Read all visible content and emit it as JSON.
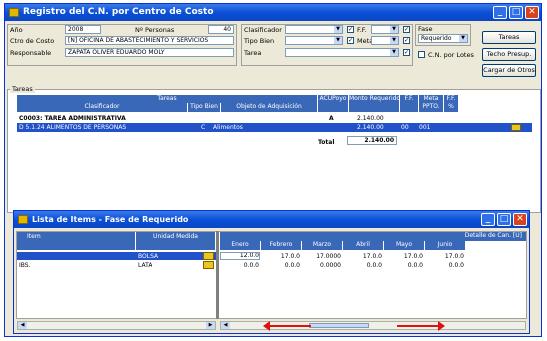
{
  "window": {
    "title": "Registro del C.N. por Centro de Costo"
  },
  "header": {
    "ano_label": "Año",
    "ano_value": "2008",
    "nro_personas_label": "Nº Personas",
    "nro_personas_value": "40",
    "centro_costo_label": "Ctro de Costo",
    "centro_costo_value": "[N] OFICINA DE ABASTECIMIENTO Y SERVICIOS",
    "responsable_label": "Responsable",
    "responsable_value": "ZAPATA OLIVER EDUARDO MOLY",
    "clasificador_label": "Clasificador",
    "tipo_bien_label": "Tipo Bien",
    "tarea_label": "Tarea",
    "ff_label": "F.F.",
    "meta_label": "Meta",
    "fase_label": "Fase",
    "fase_value": "Requerido",
    "cn_por_lotes_label": "C.N. por Lotes",
    "tareas_btn": "Tareas",
    "techo_btn": "Techo Presup.",
    "cargar_btn": "Cargar de Otros"
  },
  "tareas_group": {
    "label": "Tareas",
    "header_top": "Tareas",
    "columns": [
      "Clasificador",
      "Tipo Bien",
      "Objeto de Adquisición",
      "ACUPoyo",
      "Monto Requerido",
      "F.F.",
      "Meta",
      "F.F."
    ],
    "sub_columns": [
      "",
      "",
      "",
      "",
      "",
      "",
      "PPTO.",
      "%"
    ],
    "rows": [
      {
        "c1": "C0003: TAREA ADMINISTRATIVA",
        "c2": "",
        "c3": "",
        "c4": "A",
        "c5": "2.140.00",
        "c6": "",
        "c7": "",
        "bold": true
      },
      {
        "c1": "D    5.1.24   ALIMENTOS DE PERSONAS",
        "c2": "C",
        "c3": "Alimentos",
        "c4": "",
        "c5": "2.140.00",
        "c6": "00",
        "c7": "001",
        "selected": true
      }
    ],
    "total_label": "Total",
    "total_value": "2.140.00"
  },
  "items_window": {
    "title": "Lista de Items - Fase de Requerido",
    "col_item": "Item",
    "col_unidad": "Unidad Medida",
    "detalle_label": "Detalle de Can. [U]",
    "months": [
      "Enero",
      "Febrero",
      "Marzo",
      "Abril",
      "Mayo",
      "Junio"
    ],
    "rows": [
      {
        "item": "",
        "unidad": "BOLSA",
        "values": [
          "12.0.0",
          "17.0.0",
          "17.0000",
          "17.0.0",
          "17.0.0",
          "17.0.0"
        ],
        "selected": true
      },
      {
        "item": "IBS.",
        "unidad": "LATA",
        "values": [
          "0.0.0",
          "0.0.0",
          "0.0000",
          "0.0.0",
          "0.0.0",
          "0.0.0"
        ],
        "selected": false
      }
    ]
  },
  "colors": {
    "title_blue": "#0a4fd8",
    "grid_header": "#3a68b8",
    "selection": "#2152c9",
    "arrow_red": "#e01010"
  }
}
